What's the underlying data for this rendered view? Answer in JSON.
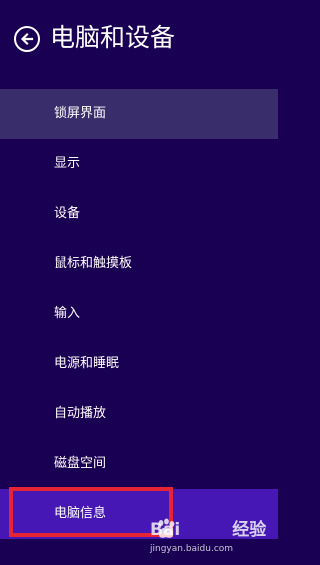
{
  "header": {
    "title": "电脑和设备",
    "back_icon": "back-arrow-circle-icon"
  },
  "menu": {
    "items": [
      {
        "label": "锁屏界面"
      },
      {
        "label": "显示"
      },
      {
        "label": "设备"
      },
      {
        "label": "鼠标和触摸板"
      },
      {
        "label": "输入"
      },
      {
        "label": "电源和睡眠"
      },
      {
        "label": "自动播放"
      },
      {
        "label": "磁盘空间"
      },
      {
        "label": "电脑信息"
      }
    ],
    "selected_index": 0,
    "highlighted_index": 8
  },
  "watermark": {
    "brand_prefix": "Bai",
    "brand_suffix": "经验",
    "url": "jingyan.baidu.com"
  },
  "colors": {
    "background": "#190052",
    "selected_bg": "#3a2d6b",
    "highlight_bg": "#4617b4",
    "annotation_border": "#e52535"
  }
}
